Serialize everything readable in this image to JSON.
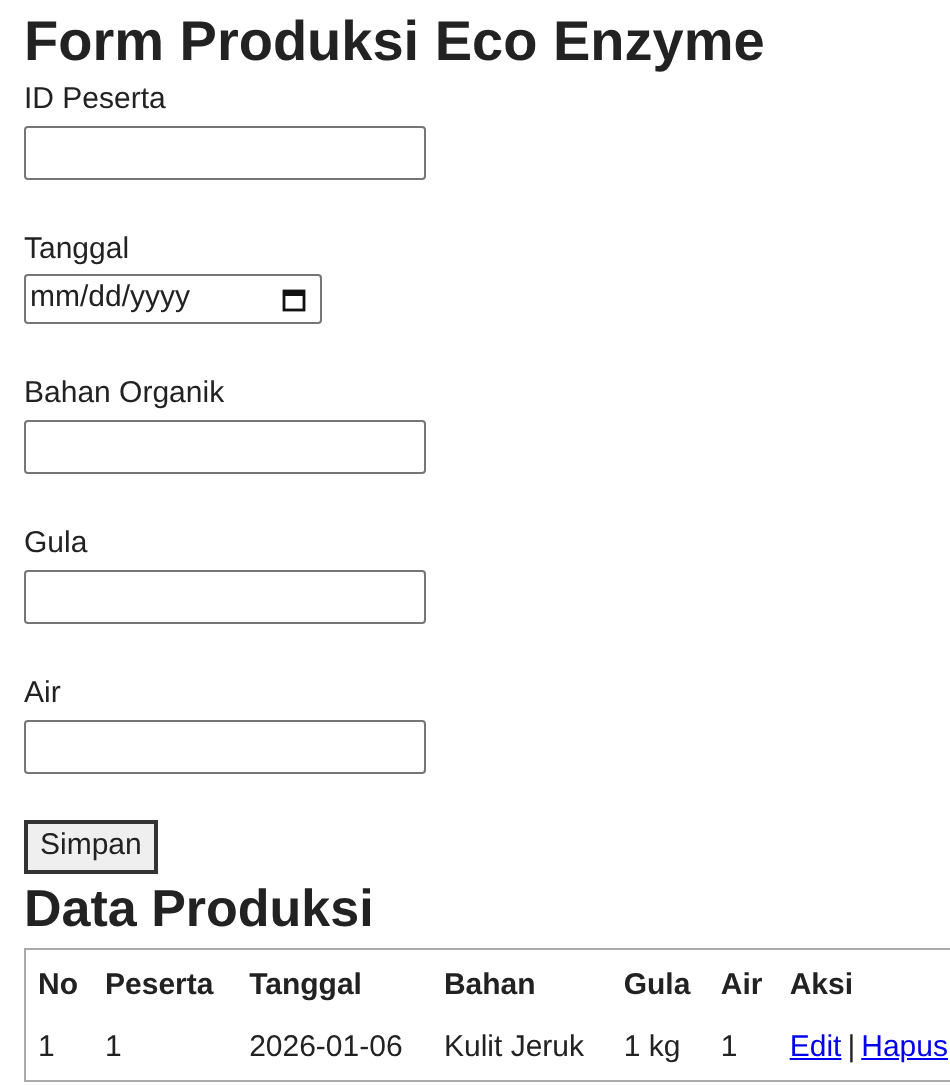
{
  "title": "Form Produksi Eco Enzyme",
  "fields": [
    {
      "label": "ID Peserta",
      "kind": "text"
    },
    {
      "label": "Tanggal",
      "kind": "date",
      "placeholder": "mm/dd/yyyy"
    },
    {
      "label": "Bahan Organik",
      "kind": "text"
    },
    {
      "label": "Gula",
      "kind": "text"
    },
    {
      "label": "Air",
      "kind": "text"
    }
  ],
  "submit": "Simpan",
  "table_title": "Data Produksi",
  "table": {
    "columns": [
      "No",
      "Peserta",
      "Tanggal",
      "Bahan",
      "Gula",
      "Air",
      "Aksi"
    ],
    "rows": [
      {
        "cells": [
          "1",
          "1",
          "2026-01-06",
          "Kulit Jeruk",
          "1 kg",
          "1"
        ],
        "actions": [
          "Edit",
          "|",
          "Hapus"
        ]
      }
    ]
  }
}
